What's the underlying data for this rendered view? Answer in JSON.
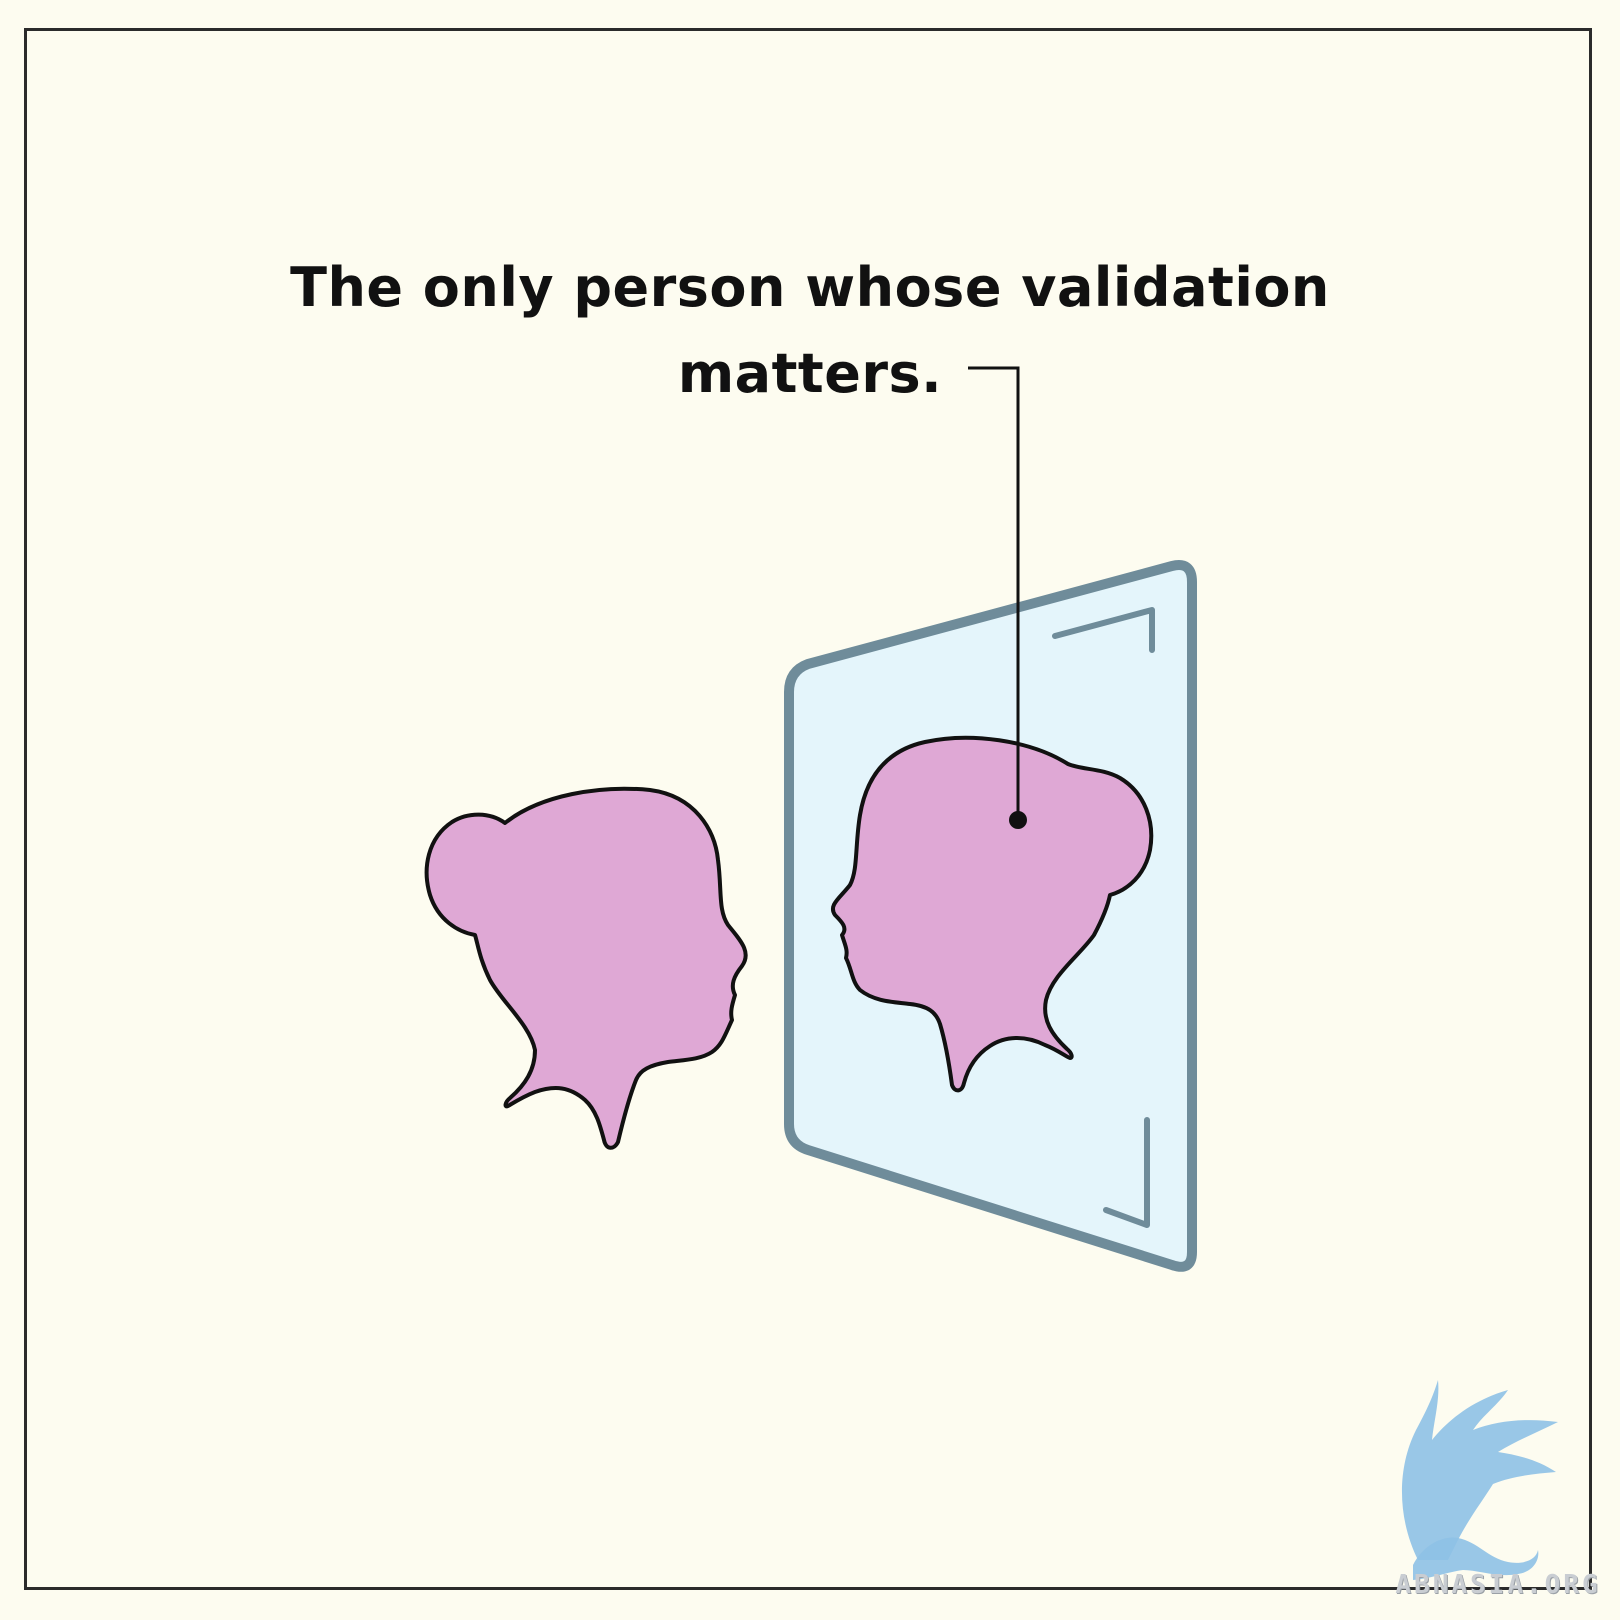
{
  "caption": {
    "line1": "The only person whose validation",
    "line2": "matters."
  },
  "watermark": {
    "text": "ABNASIA.ORG"
  },
  "colors": {
    "background": "#fdfcf0",
    "head_fill": "#dfa8d5",
    "mirror_fill": "#e4f5fb",
    "mirror_stroke": "#6f8c9a",
    "outline": "#111111",
    "logo": "#8ec1e6"
  }
}
